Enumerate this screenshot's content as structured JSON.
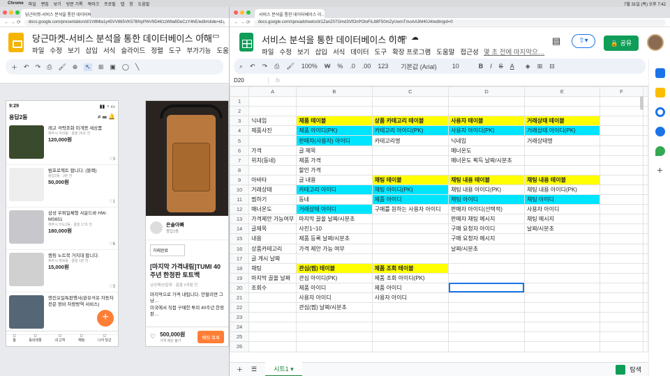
{
  "menubar": {
    "app": "Chrome",
    "items": [
      "파일",
      "편집",
      "보기",
      "방문 기록",
      "북마크",
      "프로필",
      "탭",
      "창",
      "도움말"
    ],
    "clock": "7월 31일 (목) 오후 7:42"
  },
  "left": {
    "tab": "당근마켓-서비스 분석을 통한 데이터베이스 이해",
    "url": "docs.google.com/presentation/d/1V8Mla1y45VV865VK57BNyPI6V9D461zWlla6DeCzY4hE/edit#slide=id.g120f30a…",
    "title": "당근마켓-서비스 분석을 통한 데이터베이스 이해",
    "menu": [
      "파일",
      "수정",
      "보기",
      "삽입",
      "서식",
      "슬라이드",
      "정렬",
      "도구",
      "부가기능",
      "도움말"
    ],
    "phone1": {
      "time": "9:29",
      "location": "용답2동",
      "items": [
        {
          "title": "레고 극락조화 미개봉 새상품",
          "meta": "제주시 아라동 · 끌올 26초 전",
          "price": "120,000원",
          "likes": "3",
          "color": "#3a4a2c"
        },
        {
          "title": "빔프로젝트 팝니다. (블랙)",
          "meta": "용답2동 · 3분 전",
          "price": "50,000원",
          "likes": "1",
          "color": "#eeeeee"
        },
        {
          "title": "삼성 우퍼일체형 사운드바 HW-MS651",
          "meta": "제주시 이도2동 · 끌올 17초 전",
          "price": "180,000원",
          "likes": "6",
          "color": "#c8c8cc"
        },
        {
          "title": "캠핑 노트북 거치대 팝니다.",
          "meta": "제주시 화북동 · 끌올 1분 전",
          "price": "15,000원",
          "likes": "3",
          "color": "#d0d0d0"
        },
        {
          "title": "엔진오일특판행사(완유석유 자동차 전문 정비 차량방역 서비스)",
          "meta": "",
          "price": "",
          "likes": "",
          "color": "#556677"
        }
      ],
      "nav": [
        "홈",
        "동네생활",
        "내 근처",
        "채팅",
        "나의 당근"
      ]
    },
    "phone2": {
      "seller": "은솔아빠",
      "sellerLoc": "용답2동",
      "status": "거래완료",
      "title": "[마지막 가격내림]TUMI 40주년 한정판 토트백",
      "meta": "남성패션/잡화 · 끌올 6개월 전",
      "desc1": "마지막으로 가격 내립니다. 안팔리면 그냥…",
      "desc2": "미국에서 직접 구매한 투미 40주년 한정판…",
      "price": "500,000원",
      "priceSub": "가격 제안 불가",
      "chat": "채팅 목록"
    }
  },
  "right": {
    "tab": "서비스 분석을 통한 데이터베이스 이…",
    "url": "docs.google.com/spreadsheets/d/1ZanZ07Gmd3VfOnPOtoFiL88F50mZyUwmTmoAA3M40J4/edit#gid=0",
    "title": "서비스 분석을 통한 데이터베이스 이해",
    "menu": [
      "파일",
      "수정",
      "보기",
      "삽입",
      "서식",
      "데이터",
      "도구",
      "확장 프로그램",
      "도움말",
      "접근성"
    ],
    "lastEdit": "몇 초 전에 마지막으…",
    "share": "공유",
    "toolbar": {
      "zoom": "100%",
      "currency": "₩",
      "percent": "%",
      ".0": ".0",
      ".00": ".00",
      "fmt": "123",
      "font": "기본값 (Arial)",
      "size": "10",
      "bold": "B",
      "italic": "I",
      "strike": "S",
      "underlineA": "A"
    },
    "namebox": "D20",
    "fx": "fx",
    "cols": [
      "A",
      "B",
      "C",
      "D",
      "E",
      "F"
    ],
    "rows": [
      [
        "",
        "",
        "",
        "",
        "",
        ""
      ],
      [
        "",
        "",
        "",
        "",
        "",
        ""
      ],
      [
        "닉네임",
        "제품 테이블",
        "상품 카테고리 테이블",
        "사용자 테이블",
        "거래상태 테이블",
        ""
      ],
      [
        "제품사진",
        "제품 아이디(PK)",
        "카테고리 아이디(PK)",
        "사용자 아이디(PK)",
        "거래상태 아이디(PK)",
        ""
      ],
      [
        "",
        "판매자(사용자) 아이디",
        "카테고리명",
        "닉네임",
        "거래상태명",
        ""
      ],
      [
        "가격",
        "글 제목",
        "",
        "매너온도",
        "",
        ""
      ],
      [
        "위치(동네)",
        "제품 가격",
        "",
        "매너온도 획득 날짜/시분초",
        "",
        ""
      ],
      [
        "",
        "할인 가격",
        "",
        "",
        "",
        ""
      ],
      [
        "아바타",
        "글 내용",
        "채팅 테이블",
        "채팅 내용 테이블",
        "채팅 내용 테이블",
        ""
      ],
      [
        "거래상태",
        "카테고리 아이디",
        "채팅 아이디(PK)",
        "채팅 내용 아이디(PK)",
        "채팅 내용 아이디(PK)",
        ""
      ],
      [
        "찜하기",
        "동네",
        "제품 아이디",
        "채팅 아이디",
        "채팅 아이디",
        ""
      ],
      [
        "매너온도",
        "거래상태 아이디",
        "구매를 원하는 사용자 아이디",
        "판매자 아이디(선택적)",
        "사용자 아이디",
        ""
      ],
      [
        "가격제안 가능여부",
        "마지막 끌올 날짜/시분초",
        "",
        "판매자 채팅 메시지",
        "채팅 메시지",
        ""
      ],
      [
        "글제목",
        "사진1~10",
        "",
        "구매 요청자 아이디",
        "날짜/시분초",
        ""
      ],
      [
        "내용",
        "제품 등록 날짜/시분초",
        "",
        "구매 요청자 메시지",
        "",
        ""
      ],
      [
        "상품카테고리",
        "가격 제안 가능 여부",
        "",
        "날짜/시분초",
        "",
        ""
      ],
      [
        "글 게시 날짜",
        "",
        "",
        "",
        "",
        ""
      ],
      [
        "채팅",
        "관심(찜) 테이블",
        "제품 조회 테이블",
        "",
        "",
        ""
      ],
      [
        "마지막 끌올 날짜",
        "관심 아이디(PK)",
        "제품 조회 아이디(PK)",
        "",
        "",
        ""
      ],
      [
        "조회수",
        "제품 아이디",
        "제품 아이디",
        "",
        "",
        ""
      ],
      [
        "",
        "사용자 아이디",
        "사용자 아이디",
        "",
        "",
        ""
      ],
      [
        "",
        "관심(찜) 날짜/시분초",
        "",
        "",
        "",
        ""
      ],
      [
        "",
        "",
        "",
        "",
        "",
        ""
      ],
      [
        "",
        "",
        "",
        "",
        "",
        ""
      ],
      [
        "",
        "",
        "",
        "",
        "",
        ""
      ],
      [
        "",
        "",
        "",
        "",
        "",
        ""
      ]
    ],
    "sheetTab": "시트1",
    "explore": "탐색",
    "colors": {
      "yellow": "#ffff00",
      "cyan": "#00e5ff",
      "select": "#1a73e8",
      "sheetsGreen": "#0f9d58"
    }
  }
}
